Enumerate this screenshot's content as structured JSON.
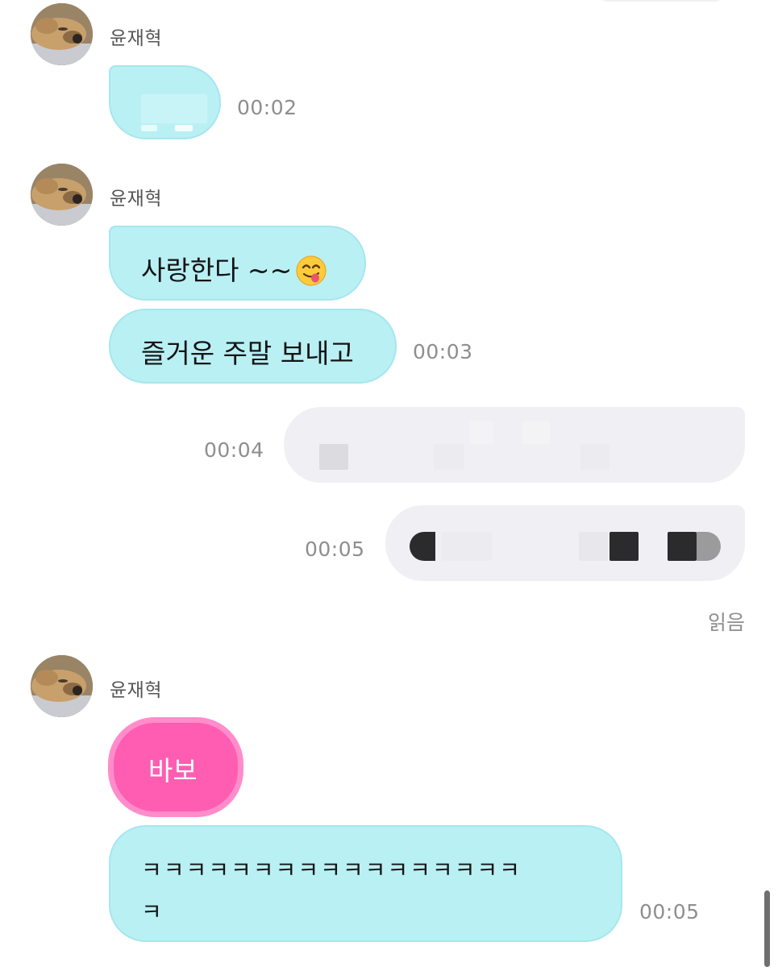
{
  "messages": [
    {
      "sender": "윤재혁",
      "bubbles": [
        {
          "text": "",
          "redacted": true
        }
      ],
      "time": "00:02"
    },
    {
      "sender": "윤재혁",
      "bubbles": [
        {
          "text": "사랑한다 ~~",
          "emoji": "savoring-food-face-emoji"
        },
        {
          "text": "즐거운 주말 보내고"
        }
      ],
      "time": "00:03"
    },
    {
      "outgoing": true,
      "bubbles": [
        {
          "text": "",
          "redacted": true
        }
      ],
      "time": "00:04"
    },
    {
      "outgoing": true,
      "bubbles": [
        {
          "text": "",
          "redacted": true
        }
      ],
      "time": "00:05",
      "status": "읽음"
    },
    {
      "sender": "윤재혁",
      "bubbles": [
        {
          "text": "바보",
          "style": "pink"
        },
        {
          "text_line1": "ㅋㅋㅋㅋㅋㅋㅋㅋㅋㅋㅋㅋㅋㅋㅋㅋㅋ",
          "text_line2": "ㅋ"
        }
      ],
      "time": "00:05"
    }
  ],
  "colors": {
    "incoming_bubble": "#b9f0f4",
    "outgoing_bubble": "#f0f0f4",
    "pink_bubble": "#ff5db2",
    "time_text": "#8e8e8e"
  }
}
